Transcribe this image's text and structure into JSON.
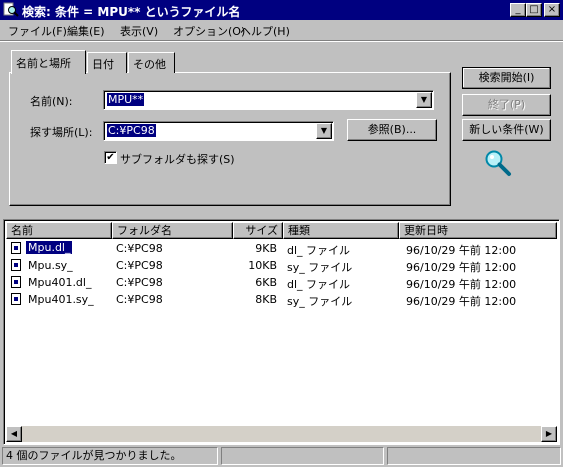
{
  "window": {
    "title": "検索: 条件 = MPU** というファイル名",
    "min": "_",
    "max": "□",
    "close": "×"
  },
  "menu": [
    "ファイル(F)",
    "編集(E)",
    "表示(V)",
    "オプション(O)",
    "ヘルプ(H)"
  ],
  "tabs": [
    "名前と場所",
    "日付",
    "その他"
  ],
  "form": {
    "name_label": "名前(N):",
    "name_value": "MPU**",
    "location_label": "探す場所(L):",
    "location_value": "C:¥PC98",
    "browse_label": "参照(B)...",
    "subfolder_label": "サブフォルダも探す(S)",
    "subfolder_checked": true
  },
  "buttons": {
    "start": "検索開始(I)",
    "stop": "終了(P)",
    "new": "新しい条件(W)"
  },
  "columns": [
    "名前",
    "フォルダ名",
    "サイズ",
    "種類",
    "更新日時"
  ],
  "files": [
    {
      "name": "Mpu.dl_",
      "folder": "C:¥PC98",
      "size": "9KB",
      "type": "dl_ ファイル",
      "modified": "96/10/29 午前 12:00",
      "selected": true
    },
    {
      "name": "Mpu.sy_",
      "folder": "C:¥PC98",
      "size": "10KB",
      "type": "sy_ ファイル",
      "modified": "96/10/29 午前 12:00",
      "selected": false
    },
    {
      "name": "Mpu401.dl_",
      "folder": "C:¥PC98",
      "size": "6KB",
      "type": "dl_ ファイル",
      "modified": "96/10/29 午前 12:00",
      "selected": false
    },
    {
      "name": "Mpu401.sy_",
      "folder": "C:¥PC98",
      "size": "8KB",
      "type": "sy_ ファイル",
      "modified": "96/10/29 午前 12:00",
      "selected": false
    }
  ],
  "status": "4 個のファイルが見つかりました。",
  "icons": {
    "title": "search-icon",
    "magnifier": "magnifier-icon",
    "file": "file-icon"
  },
  "colors": {
    "titlebar": "#000080",
    "selection": "#000080",
    "face": "#c0c0c0"
  }
}
